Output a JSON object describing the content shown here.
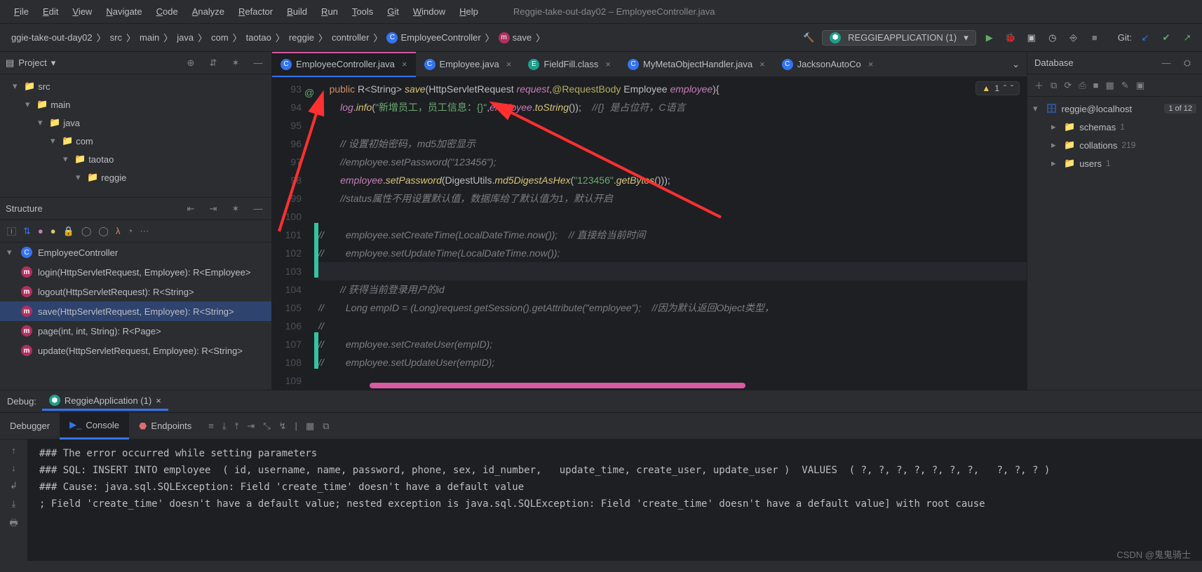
{
  "window": {
    "title": "Reggie-take-out-day02 – EmployeeController.java"
  },
  "menus": [
    "File",
    "Edit",
    "View",
    "Navigate",
    "Code",
    "Analyze",
    "Refactor",
    "Build",
    "Run",
    "Tools",
    "Git",
    "Window",
    "Help"
  ],
  "breadcrumbs": {
    "items": [
      "ggie-take-out-day02",
      "src",
      "main",
      "java",
      "com",
      "taotao",
      "reggie",
      "controller",
      "EmployeeController",
      "save"
    ]
  },
  "runConfig": {
    "name": "REGGIEAPPLICATION (1)"
  },
  "gitLabel": "Git:",
  "projectPane": {
    "title": "Project",
    "tree": [
      {
        "indent": 1,
        "open": true,
        "icon": "folder",
        "label": "src"
      },
      {
        "indent": 2,
        "open": true,
        "icon": "folder",
        "label": "main"
      },
      {
        "indent": 3,
        "open": true,
        "icon": "folder",
        "label": "java"
      },
      {
        "indent": 4,
        "open": true,
        "icon": "folder",
        "label": "com"
      },
      {
        "indent": 5,
        "open": true,
        "icon": "folder",
        "label": "taotao"
      },
      {
        "indent": 6,
        "open": true,
        "icon": "folder",
        "label": "reggie"
      }
    ]
  },
  "structurePane": {
    "title": "Structure",
    "class": "EmployeeController",
    "methods": [
      {
        "sig": "login(HttpServletRequest, Employee): R<Employee>",
        "sel": false
      },
      {
        "sig": "logout(HttpServletRequest): R<String>",
        "sel": false
      },
      {
        "sig": "save(HttpServletRequest, Employee): R<String>",
        "sel": true
      },
      {
        "sig": "page(int, int, String): R<Page>",
        "sel": false
      },
      {
        "sig": "update(HttpServletRequest, Employee): R<String>",
        "sel": false
      }
    ]
  },
  "tabs": [
    {
      "label": "EmployeeController.java",
      "icon": "c",
      "active": true,
      "modified": true
    },
    {
      "label": "Employee.java",
      "icon": "c",
      "active": false,
      "modified": false
    },
    {
      "label": "FieldFill.class",
      "icon": "e",
      "active": false,
      "modified": false
    },
    {
      "label": "MyMetaObjectHandler.java",
      "icon": "c",
      "active": false,
      "modified": false
    },
    {
      "label": "JacksonAutoCo",
      "icon": "c",
      "active": false,
      "modified": false
    }
  ],
  "warnings": {
    "count": "1"
  },
  "gutter": {
    "start": 93,
    "end": 109,
    "changed": [
      101,
      102,
      103,
      107,
      108
    ],
    "current": 103,
    "atLine": 93
  },
  "code": {
    "93": {
      "html": "    <span class='kw'>public</span> <span class='ty'>R&lt;String&gt;</span> <span class='fn'>save</span>(<span class='ty'>HttpServletRequest</span> <span class='id'>request</span>,<span class='ann'>@RequestBody</span> <span class='ty'>Employee</span> <span class='id'>employee</span>){"
    },
    "94": {
      "html": "        <span class='id'>log</span>.<span class='fn'>info</span>(<span class='str'>\"新增员工，员工信息：{}\"</span>,<span class='id'>employee</span>.<span class='fn'>toString</span>());    <span class='cm-txt'>//{}  是占位符，C语言</span>"
    },
    "95": {
      "html": " "
    },
    "96": {
      "html": "        <span class='cm-txt'>// 设置初始密码，md5加密显示</span>"
    },
    "97": {
      "html": "        <span class='cm-txt'>//employee.setPassword(\"123456\");</span>"
    },
    "98": {
      "html": "        <span class='id'>employee</span>.<span class='fn'>setPassword</span>(<span class='ty'>DigestUtils</span>.<span class='fn'>md5DigestAsHex</span>(<span class='str'>\"123456\"</span>.<span class='fn'>getBytes</span>()));"
    },
    "99": {
      "html": "        <span class='cm-txt'>//status属性不用设置默认值，数据库给了默认值为1，默认开启</span>"
    },
    "100": {
      "html": " "
    },
    "101": {
      "html": "<span class='cm-txt'>//        employee.setCreateTime(LocalDateTime.now());    // 直接给当前时间</span>"
    },
    "102": {
      "html": "<span class='cm-txt'>//        employee.setUpdateTime(LocalDateTime.now());</span>"
    },
    "103": {
      "html": " "
    },
    "104": {
      "html": "        <span class='cm-txt'>// 获得当前登录用户的id</span>"
    },
    "105": {
      "html": "<span class='cm-txt'>//        Long empID = (Long)request.getSession().getAttribute(\"employee\");    //因为默认返回Object类型，</span>"
    },
    "106": {
      "html": "<span class='cm-txt'>//</span>"
    },
    "107": {
      "html": "<span class='cm-txt'>//        employee.setCreateUser(empID);</span>"
    },
    "108": {
      "html": "<span class='cm-txt'>//        employee.setUpdateUser(empID);</span>"
    },
    "109": {
      "html": " "
    }
  },
  "database": {
    "title": "Database",
    "datasource": "reggie@localhost",
    "dsCount": "1 of 12",
    "nodes": [
      {
        "label": "schemas",
        "count": "1"
      },
      {
        "label": "collations",
        "count": "219"
      },
      {
        "label": "users",
        "count": "1"
      }
    ]
  },
  "debug": {
    "label": "Debug:",
    "runTab": "ReggieApplication (1)",
    "tabs": [
      "Debugger",
      "Console",
      "Endpoints"
    ],
    "activeTab": 1,
    "console": [
      "### The error occurred while setting parameters",
      "### SQL: INSERT INTO employee  ( id, username, name, password, phone, sex, id_number,   update_time, create_user, update_user )  VALUES  ( ?, ?, ?, ?, ?, ?, ?,   ?, ?, ? )",
      "### Cause: java.sql.SQLException: Field 'create_time' doesn't have a default value",
      "; Field 'create_time' doesn't have a default value; nested exception is java.sql.SQLException: Field 'create_time' doesn't have a default value] with root cause"
    ]
  },
  "watermark": "CSDN @鬼鬼骑士"
}
